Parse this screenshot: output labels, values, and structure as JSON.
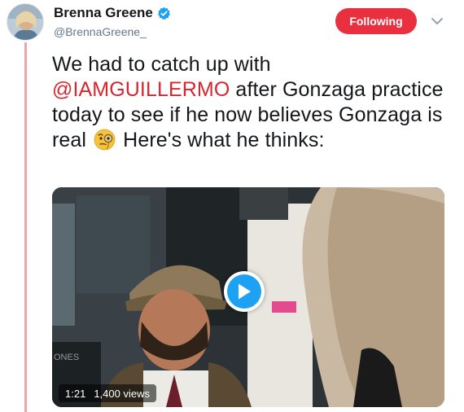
{
  "author": {
    "name": "Brenna Greene",
    "handle": "@BrennaGreene_",
    "verified": true
  },
  "follow_button": {
    "label": "Following",
    "color": "#e9303f"
  },
  "menu": {
    "icon": "chevron-down-icon"
  },
  "tweet": {
    "text_line_1": "We had to catch up with",
    "mention": "@IAMGUILLERMO",
    "text_after_mention": " after Gonzaga practice today to see if he now believes Gonzaga is real ",
    "emoji": "monocle-face-icon",
    "text_after_emoji": " Here's what he thinks:"
  },
  "video": {
    "duration": "1:21",
    "views": "1,400 views",
    "play_icon": "play-icon",
    "accent": "#1da1f2"
  },
  "colors": {
    "mention": "#d8262f",
    "thread_line": "#f1a3a9",
    "text": "#14171a",
    "muted": "#657786"
  }
}
